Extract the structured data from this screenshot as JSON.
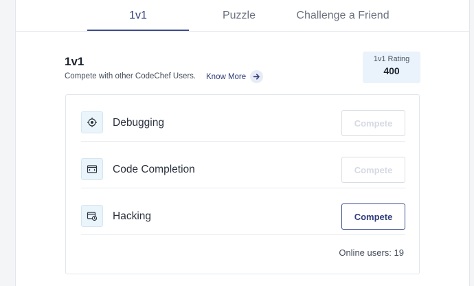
{
  "tabs": [
    {
      "label": "1v1",
      "active": true
    },
    {
      "label": "Puzzle",
      "active": false
    },
    {
      "label": "Challenge a Friend",
      "active": false
    }
  ],
  "section": {
    "title": "1v1",
    "subtitle": "Compete with other CodeChef Users.",
    "know_more": "Know More"
  },
  "rating": {
    "label": "1v1 Rating",
    "value": "400"
  },
  "modes": [
    {
      "name": "Debugging",
      "icon": "target-icon",
      "button": "Compete",
      "enabled": false
    },
    {
      "name": "Code Completion",
      "icon": "code-window-icon",
      "button": "Compete",
      "enabled": false
    },
    {
      "name": "Hacking",
      "icon": "hack-window-icon",
      "button": "Compete",
      "enabled": true
    }
  ],
  "online_users": "Online users: 19",
  "colors": {
    "accent": "#3a4a8e",
    "rating_bg": "#eaf3fb",
    "icon_bg": "#eaf4fb"
  }
}
